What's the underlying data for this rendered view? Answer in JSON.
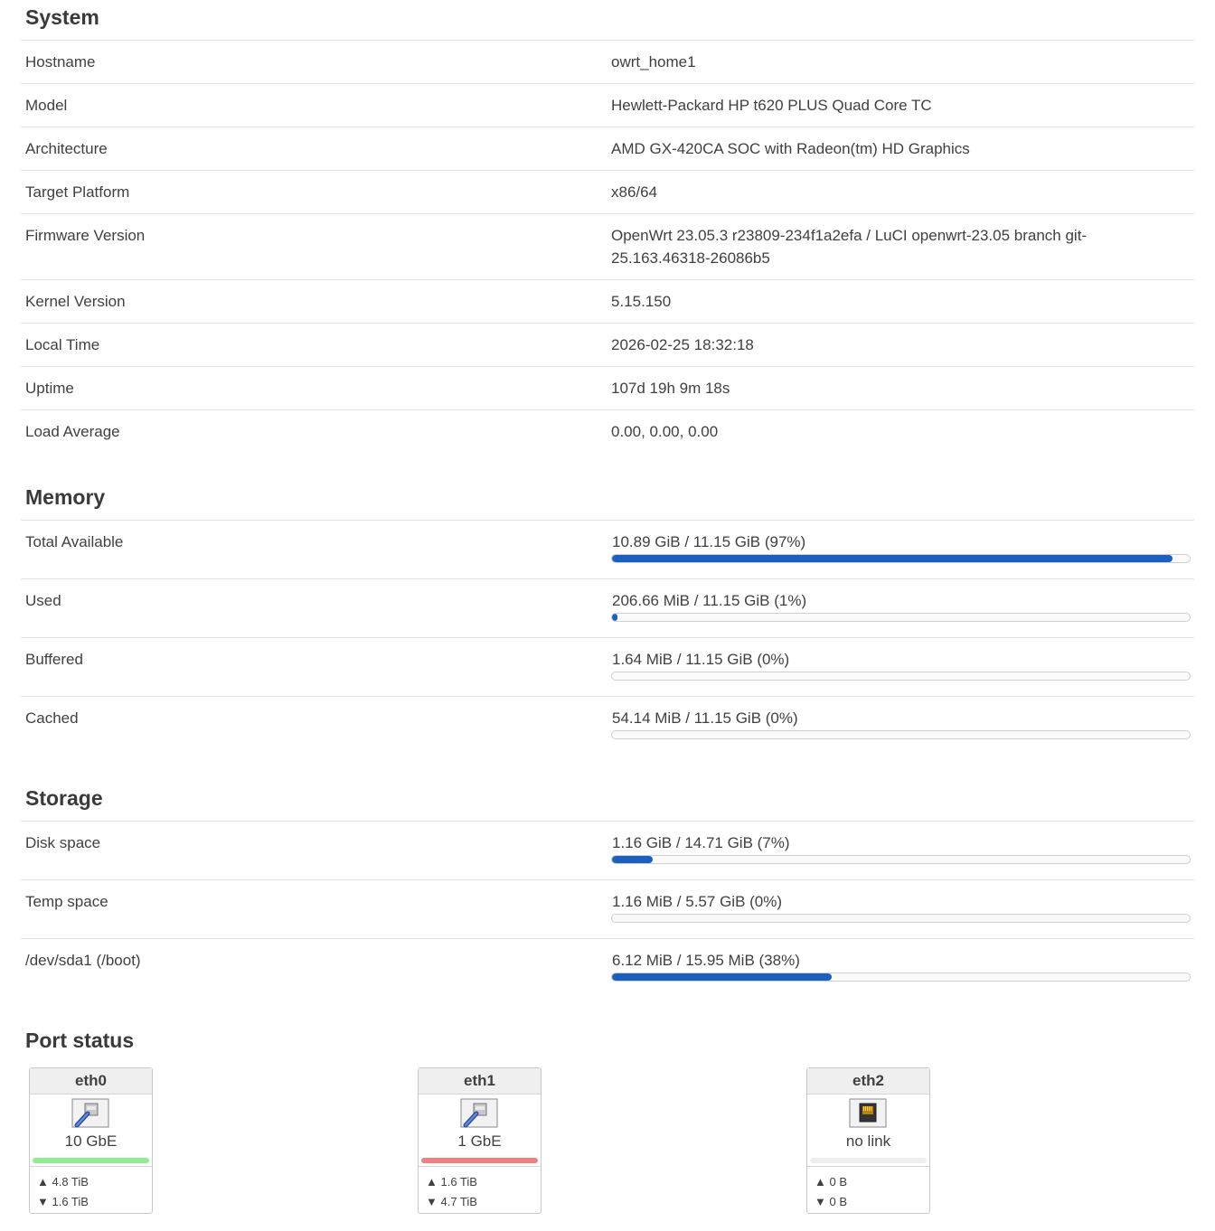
{
  "system": {
    "title": "System",
    "rows": [
      {
        "label": "Hostname",
        "value": "owrt_home1"
      },
      {
        "label": "Model",
        "value": "Hewlett-Packard HP t620 PLUS Quad Core TC"
      },
      {
        "label": "Architecture",
        "value": "AMD GX-420CA SOC with Radeon(tm) HD Graphics"
      },
      {
        "label": "Target Platform",
        "value": "x86/64"
      },
      {
        "label": "Firmware Version",
        "value": "OpenWrt 23.05.3 r23809-234f1a2efa / LuCI openwrt-23.05 branch git-25.163.46318-26086b5"
      },
      {
        "label": "Kernel Version",
        "value": "5.15.150"
      },
      {
        "label": "Local Time",
        "value": "2026-02-25 18:32:18"
      },
      {
        "label": "Uptime",
        "value": "107d 19h 9m 18s"
      },
      {
        "label": "Load Average",
        "value": "0.00, 0.00, 0.00"
      }
    ]
  },
  "memory": {
    "title": "Memory",
    "rows": [
      {
        "label": "Total Available",
        "value": "10.89 GiB / 11.15 GiB (97%)",
        "percent": 97
      },
      {
        "label": "Used",
        "value": "206.66 MiB / 11.15 GiB (1%)",
        "percent": 1
      },
      {
        "label": "Buffered",
        "value": "1.64 MiB / 11.15 GiB (0%)",
        "percent": 0
      },
      {
        "label": "Cached",
        "value": "54.14 MiB / 11.15 GiB (0%)",
        "percent": 0
      }
    ]
  },
  "storage": {
    "title": "Storage",
    "rows": [
      {
        "label": "Disk space",
        "value": "1.16 GiB / 14.71 GiB (7%)",
        "percent": 7
      },
      {
        "label": "Temp space",
        "value": "1.16 MiB / 5.57 GiB (0%)",
        "percent": 0
      },
      {
        "label": "/dev/sda1 (/boot)",
        "value": "6.12 MiB / 15.95 MiB (38%)",
        "percent": 38
      }
    ]
  },
  "ports": {
    "title": "Port status",
    "items": [
      {
        "name": "eth0",
        "speed": "10 GbE",
        "tx": "▲ 4.8 TiB",
        "rx": "▼ 1.6 TiB",
        "status_color": "#90ee90",
        "icon": "ethernet-connected-icon"
      },
      {
        "name": "eth1",
        "speed": "1 GbE",
        "tx": "▲ 1.6 TiB",
        "rx": "▼ 4.7 TiB",
        "status_color": "#f08080",
        "icon": "ethernet-connected-icon"
      },
      {
        "name": "eth2",
        "speed": "no link",
        "tx": "▲ 0 B",
        "rx": "▼ 0 B",
        "status_color": "#eeeeee",
        "icon": "ethernet-port-disconnected-icon"
      }
    ]
  },
  "colors": {
    "bar_fill": "#1b5fc0"
  }
}
